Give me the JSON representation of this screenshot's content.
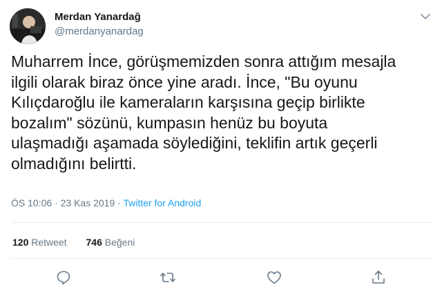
{
  "author": {
    "name": "Merdan Yanardağ",
    "handle": "@merdanyanardag"
  },
  "tweet": {
    "text": "Muharrem İnce, görüşmemizden sonra attığım mesajla\nilgili olarak biraz önce yine aradı. İnce, \"Bu oyunu\nKılıçdaroğlu  ile kameraların karşısına geçip birlikte\nbozalım\" sözünü, kumpasın henüz bu boyuta\nulaşmadığı aşamada söylediğini, teklifin artık geçerli\nolmadığını belirtti.",
    "time": "ÖS 10:06",
    "separator": "·",
    "date": "23 Kas 2019",
    "source": "Twitter for Android"
  },
  "stats": {
    "retweets_count": "120",
    "retweets_label": "Retweet",
    "likes_count": "746",
    "likes_label": "Beğeni"
  },
  "icons": {
    "more": "chevron-down-icon",
    "reply": "reply-icon",
    "retweet": "retweet-icon",
    "like": "heart-icon",
    "share": "share-icon"
  },
  "colors": {
    "text": "#14171a",
    "secondary": "#657786",
    "link": "#1da1f2",
    "divider": "#e6ecf0"
  }
}
